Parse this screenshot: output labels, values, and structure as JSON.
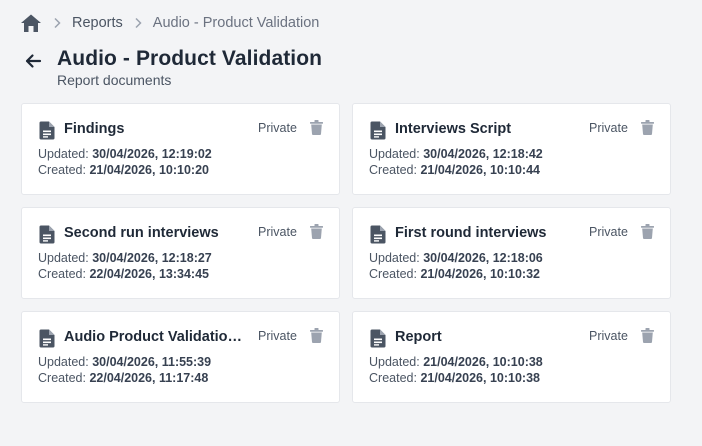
{
  "breadcrumb": {
    "home_icon": "home-icon",
    "items": [
      {
        "label": "Reports"
      },
      {
        "label": "Audio - Product Validation"
      }
    ]
  },
  "header": {
    "back_icon": "arrow-left-icon",
    "title": "Audio - Product Validation",
    "subtitle": "Report documents"
  },
  "labels": {
    "updated": "Updated:",
    "created": "Created:"
  },
  "documents": [
    {
      "title": "Findings",
      "privacy": "Private",
      "updated": "30/04/2026, 12:19:02",
      "created": "21/04/2026, 10:10:20"
    },
    {
      "title": "Interviews Script",
      "privacy": "Private",
      "updated": "30/04/2026, 12:18:42",
      "created": "21/04/2026, 10:10:44"
    },
    {
      "title": "Second run interviews",
      "privacy": "Private",
      "updated": "30/04/2026, 12:18:27",
      "created": "22/04/2026, 13:34:45"
    },
    {
      "title": "First round interviews",
      "privacy": "Private",
      "updated": "30/04/2026, 12:18:06",
      "created": "21/04/2026, 10:10:32"
    },
    {
      "title": "Audio Product Validation...",
      "privacy": "Private",
      "updated": "30/04/2026, 11:55:39",
      "created": "22/04/2026, 11:17:48"
    },
    {
      "title": "Report",
      "privacy": "Private",
      "updated": "21/04/2026, 10:10:38",
      "created": "21/04/2026, 10:10:38"
    }
  ],
  "colors": {
    "background": "#f3f4f6",
    "card": "#ffffff",
    "text": "#1f2937",
    "muted": "#4b5563",
    "icon": "#4b5563",
    "trash": "#9ca3af"
  }
}
